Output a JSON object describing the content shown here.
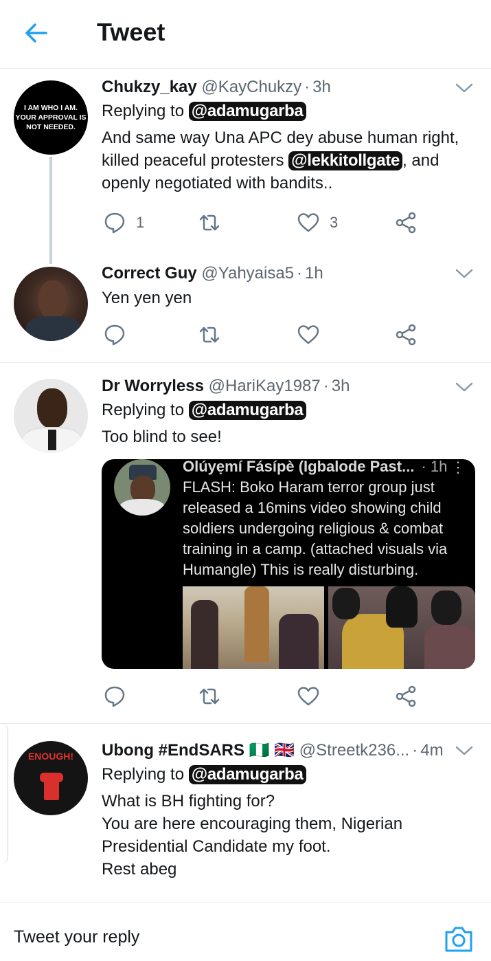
{
  "header": {
    "title": "Tweet"
  },
  "tweets": [
    {
      "name": "Chukzy_kay",
      "handle": "@KayChukzy",
      "time": "3h",
      "replying_label": "Replying to",
      "replying_to": "@adamugarba",
      "body_part1": "And same way Una APC dey abuse human right, killed peaceful protesters",
      "body_mention": "@lekkitollgate",
      "body_part2": ", and openly negotiated with bandits..",
      "avatar_text": "I AM WHO I AM.\nYOUR APPROVAL IS\nNOT NEEDED.",
      "replies": "1",
      "likes": "3"
    },
    {
      "name": "Correct Guy",
      "handle": "@Yahyaisa5",
      "time": "1h",
      "body": "Yen yen yen"
    },
    {
      "name": "Dr Worryless",
      "handle": "@HariKay1987",
      "time": "3h",
      "replying_label": "Replying to",
      "replying_to": "@adamugarba",
      "body": "Too blind to see!",
      "quote": {
        "name": "Olúyẹmí Fásípè (Igbalode Past...",
        "time": "· 1h",
        "text": "FLASH: Boko Haram terror group just released a 16mins video showing child soldiers undergoing religious & combat training in a camp. (attached visuals via Humangle) This is really disturbing."
      }
    },
    {
      "name": "Ubong #EndSARS",
      "flags": "🇳🇬 🇬🇧",
      "handle": "@Streetk236...",
      "time": "4m",
      "replying_label": "Replying to",
      "replying_to": "@adamugarba",
      "body": "What is BH fighting for?\nYou are here encouraging them, Nigerian Presidential Candidate my foot.\nRest abeg",
      "avatar_text": "ENOUGH!"
    }
  ],
  "reply_bar": {
    "placeholder": "Tweet your reply"
  },
  "colors": {
    "accent": "#1da1f2",
    "icon_gray": "#657786",
    "text": "#14171a",
    "secondary": "#5b6770"
  }
}
